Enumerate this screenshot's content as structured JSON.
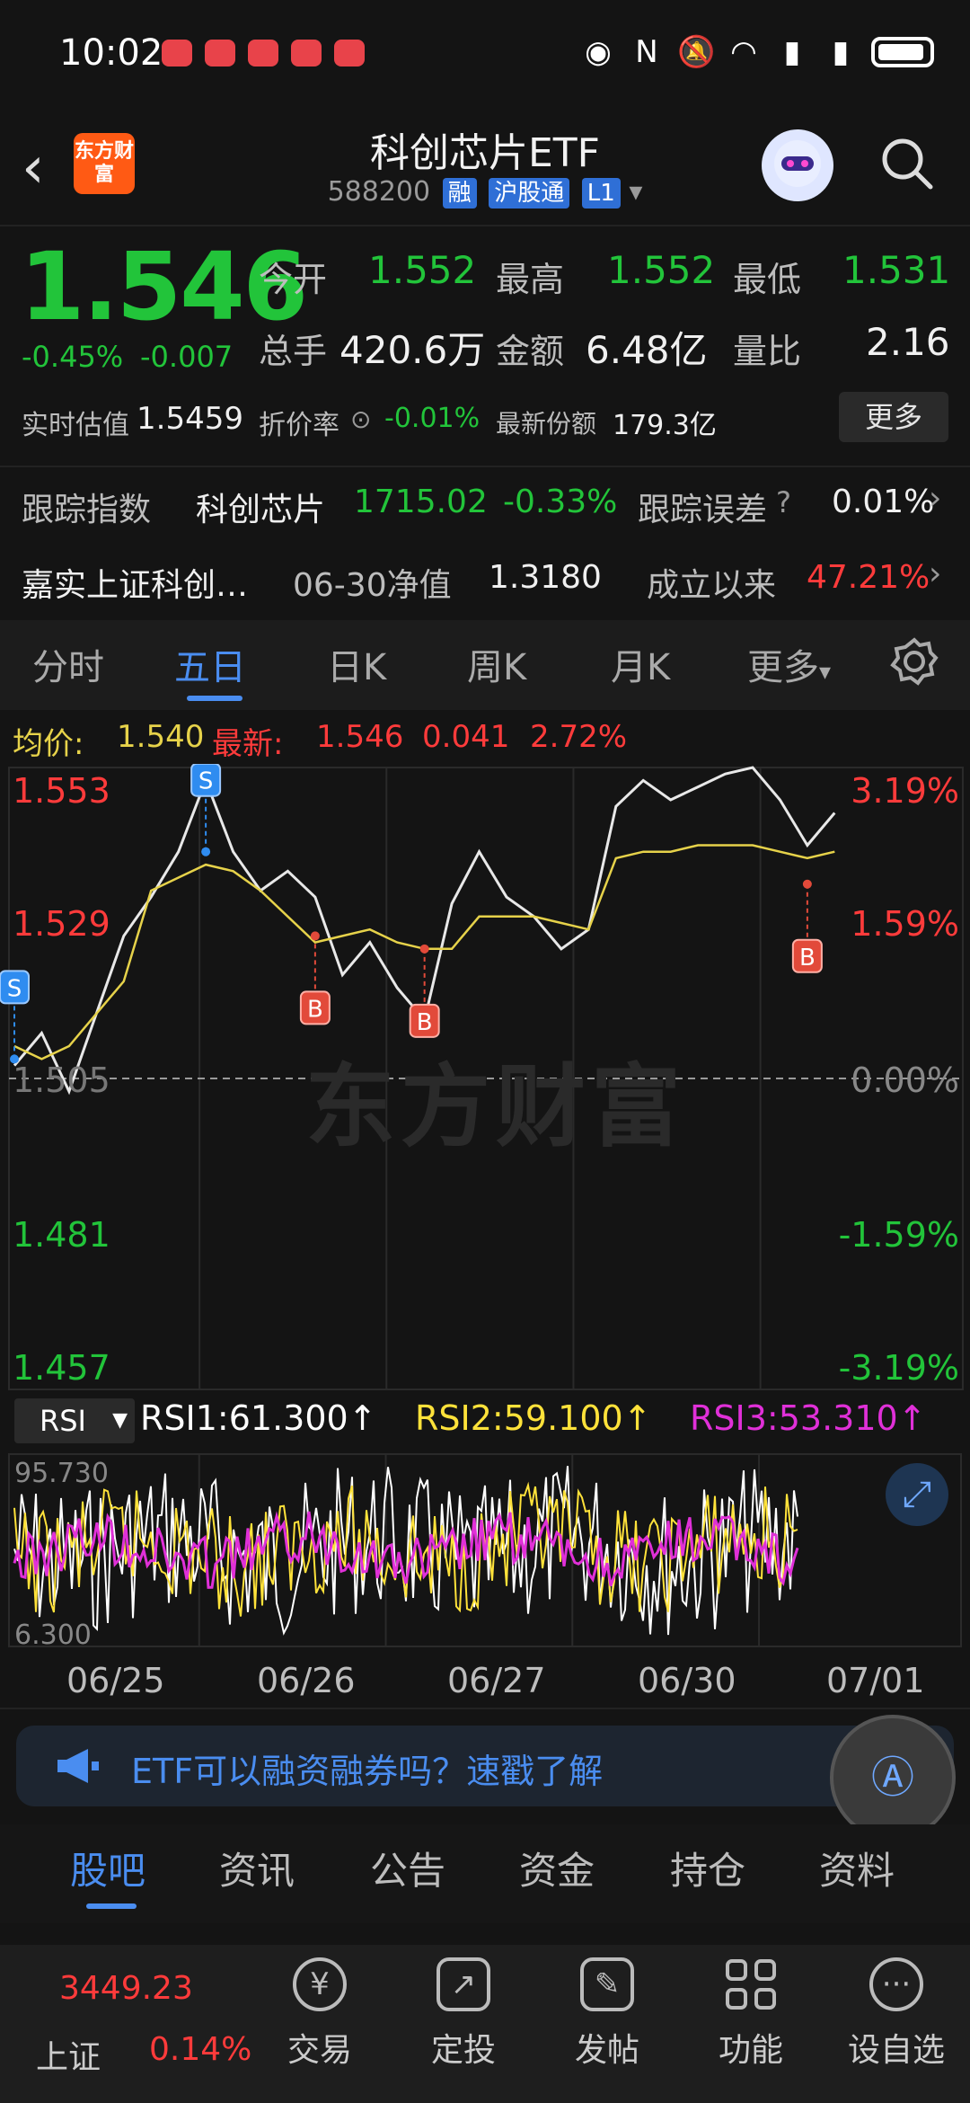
{
  "status_bar": {
    "time": "10:02"
  },
  "header": {
    "logo_text": "东方财富",
    "title": "科创芯片ETF",
    "code": "588200",
    "tags": [
      "融",
      "沪股通",
      "L1"
    ]
  },
  "quote": {
    "price": "1.546",
    "change_pct": "-0.45%",
    "change": "-0.007",
    "open_label": "今开",
    "open": "1.552",
    "high_label": "最高",
    "high": "1.552",
    "low_label": "最低",
    "low": "1.531",
    "volume_label": "总手",
    "volume": "420.6万",
    "amount_label": "金额",
    "amount": "6.48亿",
    "vol_ratio_label": "量比",
    "vol_ratio": "2.16",
    "iopv_label": "实时估值",
    "iopv": "1.5459",
    "premium_label": "折价率",
    "premium": "-0.01%",
    "shares_label": "最新份额",
    "shares": "179.3亿",
    "more_label": "更多"
  },
  "tracking": {
    "index_label": "跟踪指数",
    "index_name": "科创芯片",
    "index_value": "1715.02",
    "index_change": "-0.33%",
    "error_label": "跟踪误差",
    "error_value": "0.01%",
    "fund_name": "嘉实上证科创…",
    "nav_label": "06-30净值",
    "nav": "1.3180",
    "since_label": "成立以来",
    "since_value": "47.21%"
  },
  "chart_tabs": [
    "分时",
    "五日",
    "日K",
    "周K",
    "月K",
    "更多"
  ],
  "chart_info": {
    "avg_label": "均价:",
    "avg": "1.540",
    "latest_label": "最新:",
    "latest": "1.546",
    "diff": "0.041",
    "pct": "2.72%"
  },
  "watermark": "东方财富",
  "rsi": {
    "selector": "RSI",
    "rsi1": "RSI1:61.300↑",
    "rsi2": "RSI2:59.100↑",
    "rsi3": "RSI3:53.310↑",
    "max": "95.730",
    "min": "6.300"
  },
  "colors": {
    "up": "#ff3b3b",
    "down": "#22c43a",
    "accent": "#4a8df0",
    "avg": "#e6d24a",
    "rsi1": "#ffffff",
    "rsi2": "#ffe23a",
    "rsi3": "#e030d8"
  },
  "chart_data": {
    "type": "line",
    "x": [
      "06/25",
      "06/26",
      "06/27",
      "06/30",
      "07/01"
    ],
    "y_ticks": [
      "1.553",
      "1.529",
      "1.505",
      "1.481",
      "1.457"
    ],
    "y_pct_ticks": [
      "3.19%",
      "1.59%",
      "0.00%",
      "-1.59%",
      "-3.19%"
    ],
    "ylim": [
      1.457,
      1.553
    ],
    "series": [
      {
        "values": [
          1.507,
          1.512,
          1.503,
          1.515,
          1.527,
          1.533,
          1.54,
          1.551,
          1.54,
          1.534,
          1.537,
          1.533,
          1.521,
          1.526,
          1.519,
          1.514,
          1.532,
          1.54,
          1.533,
          1.53,
          1.525,
          1.528,
          1.547,
          1.551,
          1.548,
          1.55,
          1.552,
          1.553,
          1.548,
          1.541,
          1.546
        ]
      },
      {
        "values": [
          1.51,
          1.508,
          1.51,
          1.515,
          1.52,
          1.534,
          1.536,
          1.538,
          1.537,
          1.534,
          1.53,
          1.526,
          1.527,
          1.528,
          1.526,
          1.525,
          1.525,
          1.53,
          1.53,
          1.53,
          1.529,
          1.528,
          1.539,
          1.54,
          1.54,
          1.541,
          1.541,
          1.541,
          1.54,
          1.539,
          1.54
        ]
      }
    ],
    "markers": [
      {
        "label": "S",
        "x_index": 0,
        "value": 1.508
      },
      {
        "label": "S",
        "x_index": 7,
        "value": 1.54
      },
      {
        "label": "B",
        "x_index": 11,
        "value": 1.527
      },
      {
        "label": "B",
        "x_index": 15,
        "value": 1.525
      },
      {
        "label": "B",
        "x_index": 29,
        "value": 1.535
      }
    ]
  },
  "banner": {
    "text": "ETF可以融资融券吗？速戳了解"
  },
  "content_tabs": [
    "股吧",
    "资讯",
    "公告",
    "资金",
    "持仓",
    "资料"
  ],
  "footer": {
    "index_value": "3449.23",
    "index_name": "上证",
    "index_change": "0.14%",
    "items": [
      {
        "label": "交易",
        "icon": "yen-icon"
      },
      {
        "label": "定投",
        "icon": "chart-frame-icon"
      },
      {
        "label": "发帖",
        "icon": "pencil-icon"
      },
      {
        "label": "功能",
        "icon": "grid-icon"
      },
      {
        "label": "设自选",
        "icon": "dots-icon"
      }
    ]
  }
}
